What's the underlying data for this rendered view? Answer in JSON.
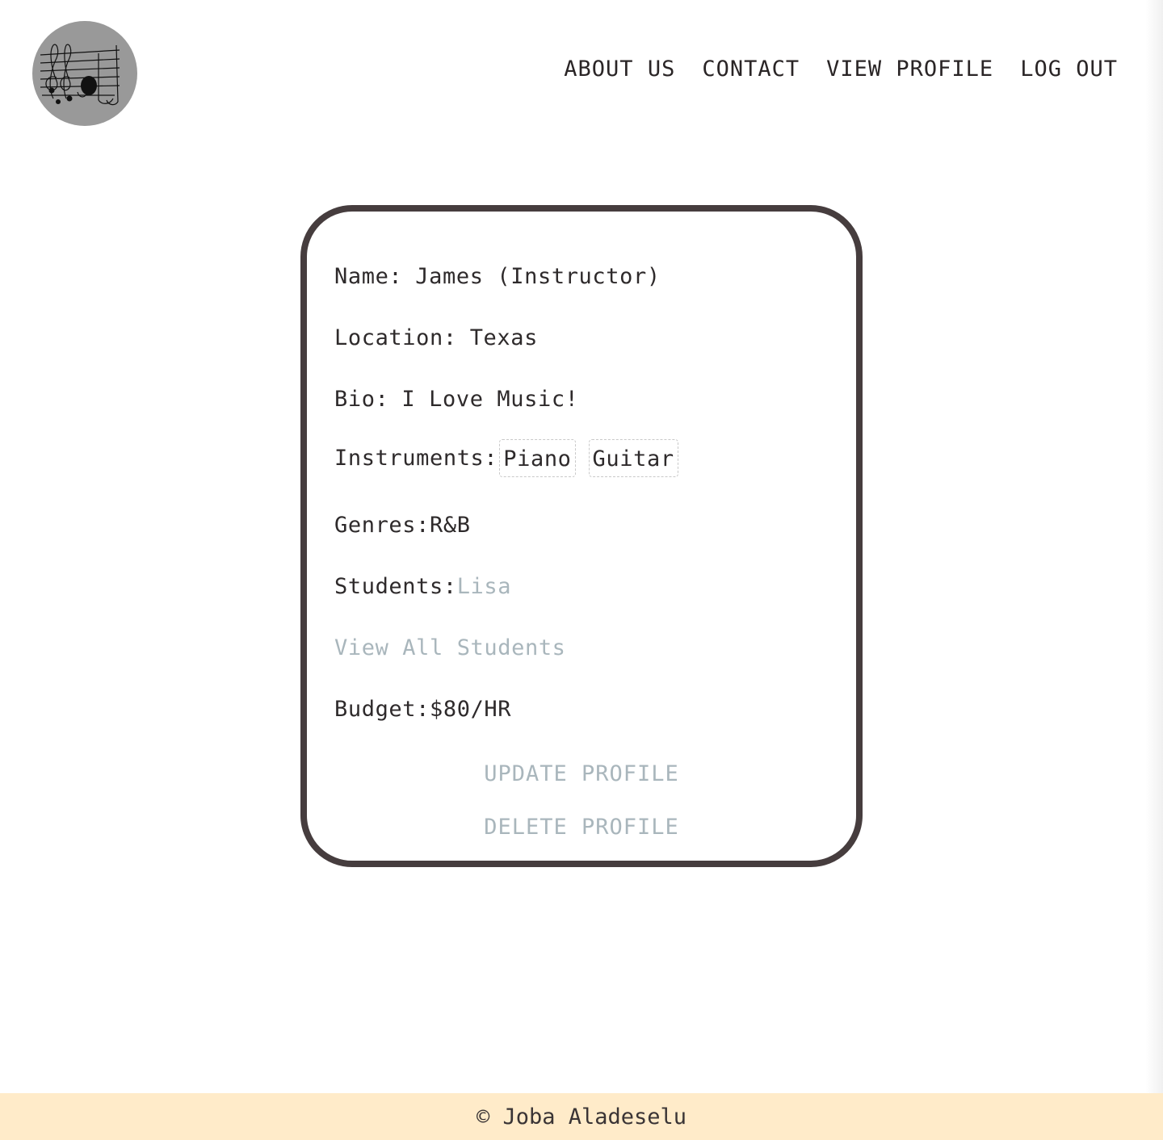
{
  "header": {
    "logo": "music-staff-logo",
    "nav": [
      {
        "label": "ABOUT US"
      },
      {
        "label": "CONTACT"
      },
      {
        "label": "VIEW PROFILE"
      },
      {
        "label": "LOG OUT"
      }
    ]
  },
  "profile": {
    "name_label": "Name:",
    "name_value": "James (Instructor)",
    "location_label": "Location:",
    "location_value": "Texas",
    "bio_label": "Bio:",
    "bio_value": "I Love Music!",
    "instruments_label": "Instruments:",
    "instruments": [
      "Piano",
      "Guitar"
    ],
    "genres_label": "Genres:",
    "genres_value": "R&B",
    "students_label": "Students:",
    "students": [
      "Lisa"
    ],
    "view_all_students": "View All Students",
    "budget_label": "Budget:",
    "budget_value": "$80/HR",
    "update_button": "UPDATE PROFILE",
    "delete_button": "DELETE PROFILE"
  },
  "footer": {
    "copyright": "© Joba Aladeselu"
  },
  "colors": {
    "card_border": "#463d3e",
    "link": "#a9b6bc",
    "footer_bg": "#ffebc9",
    "logo_bg": "#999999"
  }
}
